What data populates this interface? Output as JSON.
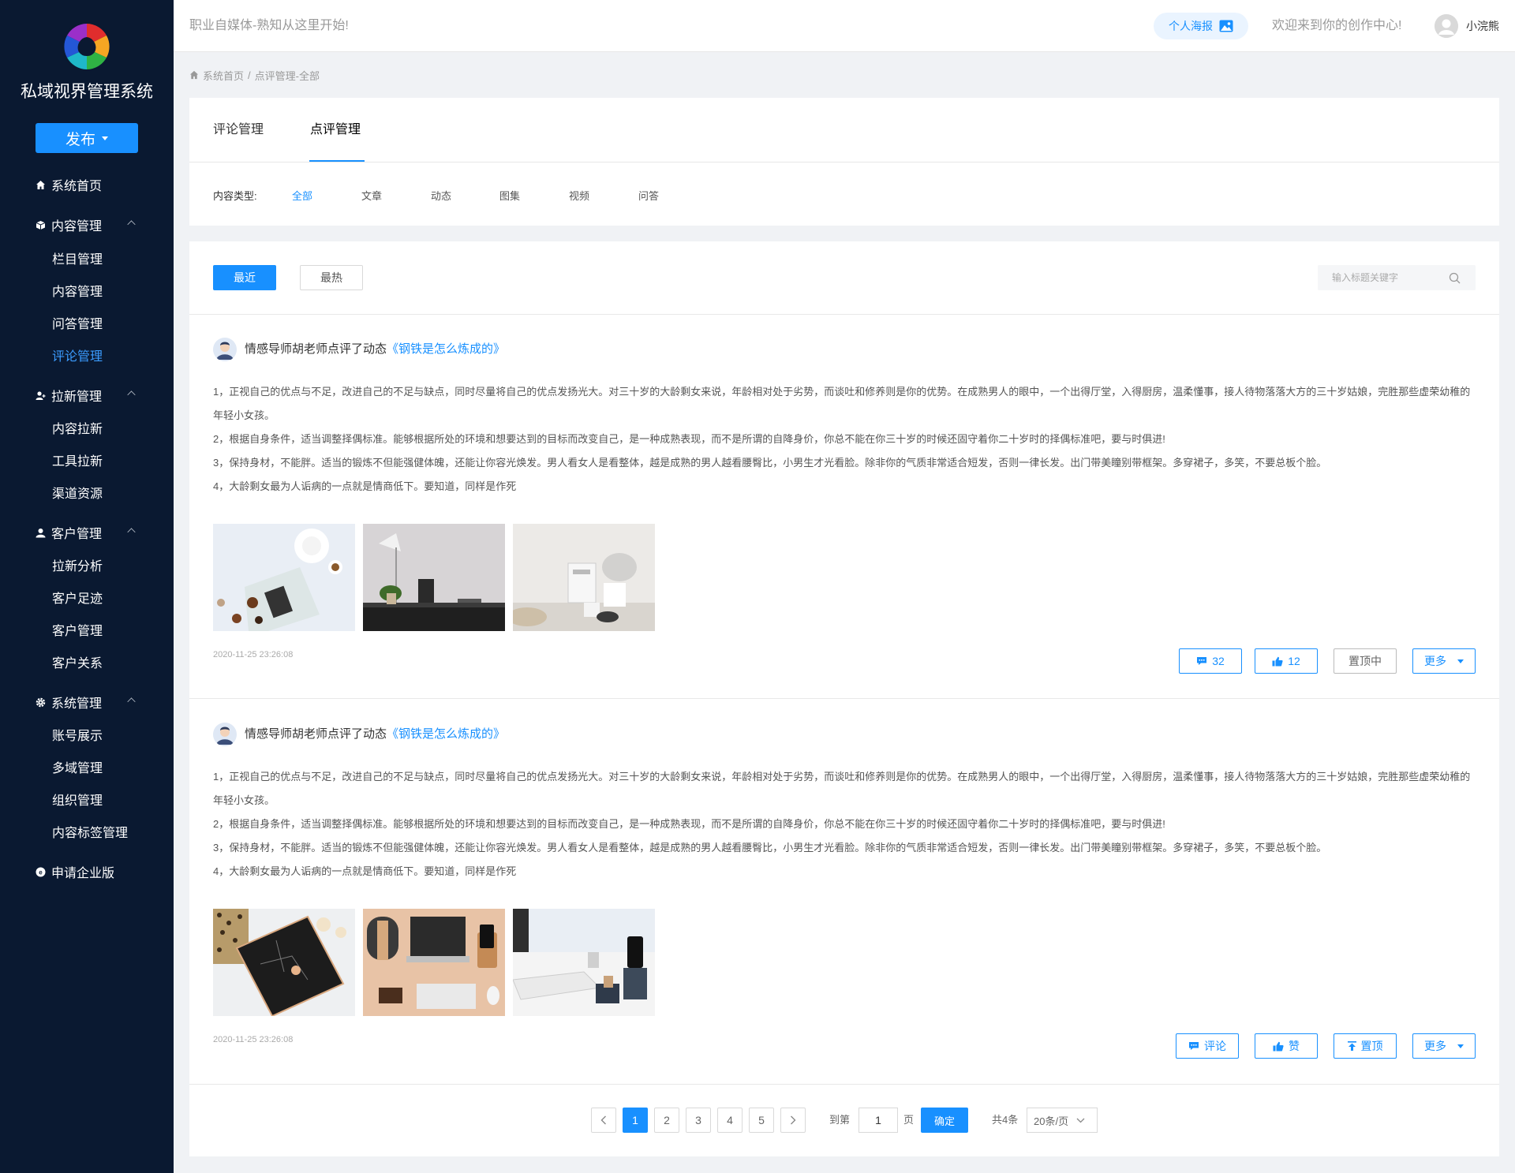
{
  "sidebar": {
    "title": "私域视界管理系统",
    "publish_label": "发布",
    "groups": [
      {
        "label": "系统首页"
      },
      {
        "label": "内容管理",
        "items": [
          "栏目管理",
          "内容管理",
          "问答管理",
          "评论管理"
        ]
      },
      {
        "label": "拉新管理",
        "items": [
          "内容拉新",
          "工具拉新",
          "渠道资源"
        ]
      },
      {
        "label": "客户管理",
        "items": [
          "拉新分析",
          "客户足迹",
          "客户管理",
          "客户关系"
        ]
      },
      {
        "label": "系统管理",
        "items": [
          "账号展示",
          "多域管理",
          "组织管理",
          "内容标签管理"
        ]
      },
      {
        "label": "申请企业版"
      }
    ],
    "active_item": "评论管理"
  },
  "topbar": {
    "slogan": "职业自媒体-熟知从这里开始!",
    "poster_label": "个人海报",
    "welcome": "欢迎来到你的创作中心!",
    "username": "小浣熊"
  },
  "breadcrumb": [
    "系统首页",
    "/",
    "点评管理-全部"
  ],
  "tabs": [
    {
      "label": "评论管理"
    },
    {
      "label": "点评管理",
      "active": true
    }
  ],
  "content_type": {
    "label": "内容类型:",
    "options": [
      "全部",
      "文章",
      "动态",
      "图集",
      "视频",
      "问答"
    ],
    "selected": "全部"
  },
  "filters": {
    "recent_label": "最近",
    "hot_label": "最热",
    "search_placeholder": "输入标题关键字"
  },
  "posts": [
    {
      "header": "情感导师胡老师点评了动态",
      "link": "《钢铁是怎么炼成的》",
      "paragraphs": [
        "1，正视自己的优点与不足，改进自己的不足与缺点，同时尽量将自己的优点发扬光大。对三十岁的大龄剩女来说，年龄相对处于劣势，而谈吐和修养则是你的优势。在成熟男人的眼中，一个出得厅堂，入得厨房，温柔懂事，接人待物落落大方的三十岁姑娘，完胜那些虚荣幼稚的年轻小女孩。",
        "2，根据自身条件，适当调整择偶标准。能够根据所处的环境和想要达到的目标而改变自己，是一种成熟表现，而不是所谓的自降身价，你总不能在你三十岁的时候还固守着你二十岁时的择偶标准吧，要与时俱进!",
        "3，保持身材，不能胖。适当的锻炼不但能强健体魄，还能让你容光焕发。男人看女人是看整体，越是成熟的男人越看腰臀比，小男生才光看脸。除非你的气质非常适合短发，否则一律长发。出门带美瞳别带框架。多穿裙子，多笑，不要总板个脸。",
        "4，大龄剩女最为人诟病的一点就是情商低下。要知道，同样是作死"
      ],
      "time": "2020-11-25 23:26:08",
      "actions": {
        "comment": "32",
        "like": "12",
        "top": "置顶中",
        "more": "更多"
      }
    },
    {
      "header": "情感导师胡老师点评了动态",
      "link": "《钢铁是怎么炼成的》",
      "paragraphs": [
        "1，正视自己的优点与不足，改进自己的不足与缺点，同时尽量将自己的优点发扬光大。对三十岁的大龄剩女来说，年龄相对处于劣势，而谈吐和修养则是你的优势。在成熟男人的眼中，一个出得厅堂，入得厨房，温柔懂事，接人待物落落大方的三十岁姑娘，完胜那些虚荣幼稚的年轻小女孩。",
        "2，根据自身条件，适当调整择偶标准。能够根据所处的环境和想要达到的目标而改变自己，是一种成熟表现，而不是所谓的自降身价，你总不能在你三十岁的时候还固守着你二十岁时的择偶标准吧，要与时俱进!",
        "3，保持身材，不能胖。适当的锻炼不但能强健体魄，还能让你容光焕发。男人看女人是看整体，越是成熟的男人越看腰臀比，小男生才光看脸。除非你的气质非常适合短发，否则一律长发。出门带美瞳别带框架。多穿裙子，多笑，不要总板个脸。",
        "4，大龄剩女最为人诟病的一点就是情商低下。要知道，同样是作死"
      ],
      "time": "2020-11-25 23:26:08",
      "actions": {
        "comment": "评论",
        "like": "赞",
        "top": "置顶",
        "more": "更多"
      }
    }
  ],
  "pagination": {
    "pages": [
      "1",
      "2",
      "3",
      "4",
      "5"
    ],
    "current": "1",
    "goto_label": "到第",
    "goto_value": "1",
    "page_unit": "页",
    "confirm_label": "确定",
    "total": "共4条",
    "page_size": "20条/页"
  },
  "colors": {
    "sidebar_bg": "#0a1931",
    "accent": "#1890ff",
    "active_nav": "#3b9cff"
  }
}
